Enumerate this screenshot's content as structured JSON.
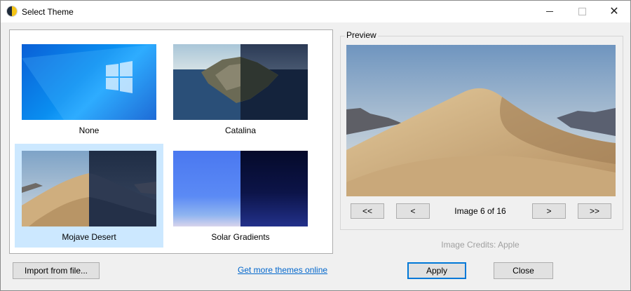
{
  "window": {
    "title": "Select Theme",
    "controls": {
      "minimize_icon": "minimize-icon",
      "maximize_icon": "maximize-icon",
      "close_glyph": "✕"
    }
  },
  "themes": [
    {
      "label": "None",
      "selected": false,
      "thumb": "windows-10-wallpaper"
    },
    {
      "label": "Catalina",
      "selected": false,
      "thumb": "catalina-island-day-night"
    },
    {
      "label": "Mojave Desert",
      "selected": true,
      "thumb": "mojave-dunes-day-night"
    },
    {
      "label": "Solar Gradients",
      "selected": false,
      "thumb": "solar-gradient-day-night"
    }
  ],
  "preview": {
    "legend": "Preview",
    "first_label": "<<",
    "prev_label": "<",
    "counter": "Image 6 of 16",
    "next_label": ">",
    "last_label": ">>",
    "credits": "Image Credits: Apple"
  },
  "footer": {
    "import_label": "Import from file...",
    "more_link": "Get more themes online",
    "apply_label": "Apply",
    "close_label": "Close"
  },
  "colors": {
    "selection": "#cce8ff",
    "link": "#0066cc",
    "default_button_border": "#0078d7"
  }
}
